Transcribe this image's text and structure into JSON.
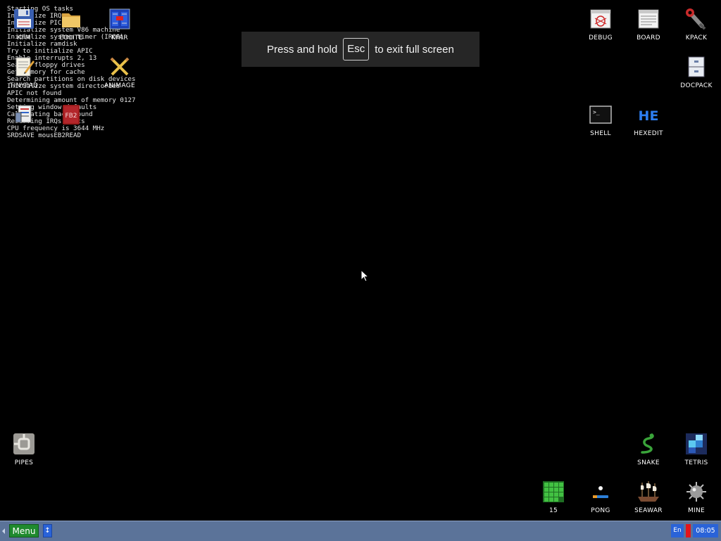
{
  "boot_log": "Starting OS tasks\nInitialize IRQs\nInitialize PIC\nInitialize system V86 machine\nInitialize system timer (IRQ0)\nInitialize ramdisk\nTry to initialize APIC\nEnable interrupts 2, 13\nSearch floppy drives\nGet memory for cache\nSearch partitions on disk devices\nInitialize system directories\nAPIC not found\nDetermining amount of memory 0127\nSetting window defaults\nCalculating background\nReserving IRQs ports\nCPU frequency is 3644 MHz\nSRDSAVE mousEB2READ",
  "desktop_icons": {
    "kfm": {
      "label": "KFM",
      "icon": "floppy-icon"
    },
    "eolite": {
      "label": "EOLITE",
      "icon": "folder-icon"
    },
    "kfar": {
      "label": "KFAR",
      "icon": "kfar-icon"
    },
    "tinypad": {
      "label": "TINYPAD",
      "icon": "notepad-icon"
    },
    "animage": {
      "label": "ANIMAGE",
      "icon": "pencil-icon"
    },
    "cedit": {
      "label": "",
      "icon": "document-icon"
    },
    "fb2read": {
      "label": "",
      "icon": "fb2-book-icon",
      "badge": "FB2"
    },
    "debug": {
      "label": "DEBUG",
      "icon": "bug-window-icon"
    },
    "board": {
      "label": "BOARD",
      "icon": "board-window-icon"
    },
    "kpack": {
      "label": "KPACK",
      "icon": "wrench-icon"
    },
    "docpack": {
      "label": "DOCPACK",
      "icon": "cabinet-icon"
    },
    "shell": {
      "label": "SHELL",
      "icon": "terminal-icon"
    },
    "hexedit": {
      "label": "HEXEDIT",
      "icon": "hex-icon",
      "badge": "HE"
    },
    "pipes": {
      "label": "PIPES",
      "icon": "pipes-icon"
    },
    "snake": {
      "label": "SNAKE",
      "icon": "snake-icon"
    },
    "tetris": {
      "label": "TETRIS",
      "icon": "tetris-icon"
    },
    "fifteen": {
      "label": "15",
      "icon": "grid-icon"
    },
    "pong": {
      "label": "PONG",
      "icon": "pong-icon"
    },
    "seawar": {
      "label": "SEAWAR",
      "icon": "ship-icon"
    },
    "mine": {
      "label": "MINE",
      "icon": "mine-icon"
    }
  },
  "fullscreen_banner": {
    "before": "Press and hold",
    "key": "Esc",
    "after": "to exit full screen"
  },
  "taskbar": {
    "menu_label": "Menu",
    "switch_label": "↕",
    "language": "En",
    "clock": "08:05"
  },
  "colors": {
    "desktop_bg": "#000000",
    "taskbar_bg": "#5b7399",
    "menu_green": "#1f8a2e",
    "panel_blue": "#2a63d8",
    "indicator_red": "#e3141b"
  }
}
